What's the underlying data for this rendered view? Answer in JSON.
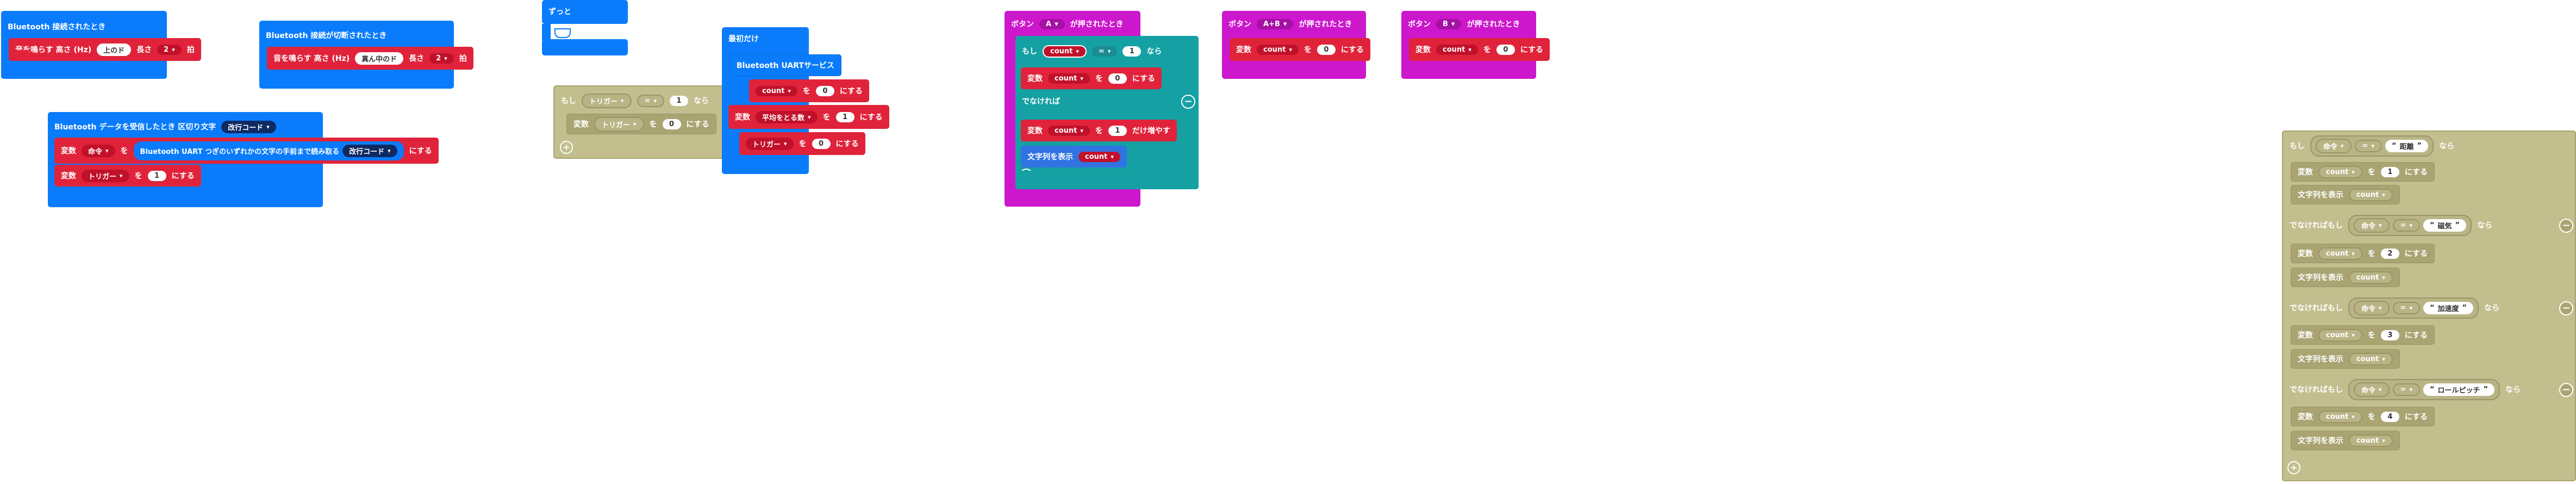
{
  "bt_connected": {
    "hat": "Bluetooth 接続されたとき",
    "play_label": "音を鳴らす 高さ (Hz)",
    "play_note": "上のド",
    "play_len_label": "長さ",
    "play_len": "2",
    "play_unit": "拍"
  },
  "bt_disconnected": {
    "hat": "Bluetooth 接続が切断されたとき",
    "play_label": "音を鳴らす 高さ (Hz)",
    "play_note": "真ん中のド",
    "play_len_label": "長さ",
    "play_len": "2",
    "play_unit": "拍"
  },
  "bt_data": {
    "hat": "Bluetooth データを受信したとき 区切り文字",
    "delimiter": "改行コード",
    "row1_label": "変数",
    "row1_var": "命令",
    "row1_op": "を",
    "row1_read": "Bluetooth UART つぎのいずれかの文字の手前まで読み取る",
    "row1_delim": "改行コード",
    "row1_tail": "にする",
    "row2_label": "変数",
    "row2_var": "トリガー",
    "row2_op": "を",
    "row2_val": "1",
    "row2_tail": "にする"
  },
  "forever": {
    "label": "ずっと"
  },
  "forever_if": {
    "if_label": "もし",
    "var": "トリガー",
    "cmp": "=",
    "val": "1",
    "then": "なら",
    "set_label": "変数",
    "set_var": "トリガー",
    "set_op": "を",
    "set_val": "0",
    "set_tail": "にする"
  },
  "on_start": {
    "hat": "最初だけ",
    "uart": "Bluetooth UARTサービス",
    "r1_var": "count",
    "r1_op": "を",
    "r1_val": "0",
    "r1_tail": "にする",
    "r2_var": "平均をとる数",
    "r2_op": "を",
    "r2_val": "1",
    "r2_tail": "にする",
    "r3_var": "トリガー",
    "r3_op": "を",
    "r3_val": "0",
    "r3_tail": "にする",
    "r2_prefix": "変数"
  },
  "button_a": {
    "hat": "ボタン",
    "btn": "A",
    "hat_tail": "が押されたとき",
    "if_label": "もし",
    "if_var": "count",
    "if_cmp": "=",
    "if_val": "1",
    "if_then": "なら",
    "t_label": "変数",
    "t_var": "count",
    "t_op": "を",
    "t_val": "0",
    "t_tail": "にする",
    "else_label": "でなければ",
    "e_label": "変数",
    "e_var": "count",
    "e_op": "を",
    "e_val": "1",
    "e_tail": "だけ増やす",
    "show_label": "文字列を表示",
    "show_var": "count"
  },
  "button_ab": {
    "hat": "ボタン",
    "btn": "A+B",
    "hat_tail": "が押されたとき",
    "label": "変数",
    "var": "count",
    "op": "を",
    "val": "0",
    "tail": "にする"
  },
  "button_b": {
    "hat": "ボタン",
    "btn": "B",
    "hat_tail": "が押されたとき",
    "label": "変数",
    "var": "count",
    "op": "を",
    "val": "0",
    "tail": "にする"
  },
  "command_chain": {
    "if_label": "もし",
    "elif_label": "でなければもし",
    "then": "なら",
    "cmp": "=",
    "var": "命令",
    "set_label": "変数",
    "set_var": "count",
    "set_op": "を",
    "set_tail": "にする",
    "show_label": "文字列を表示",
    "show_var": "count",
    "branches": [
      {
        "text": "距離",
        "val": "1"
      },
      {
        "text": "磁気",
        "val": "2"
      },
      {
        "text": "加速度",
        "val": "3"
      },
      {
        "text": "ロールピッチ",
        "val": "4"
      }
    ]
  },
  "colors": {
    "bluetooth": "#0a7cfb",
    "variables": "#e0233a",
    "input": "#cc17cc",
    "logic": "#15a0a3",
    "disabled": "#c3be8e"
  }
}
